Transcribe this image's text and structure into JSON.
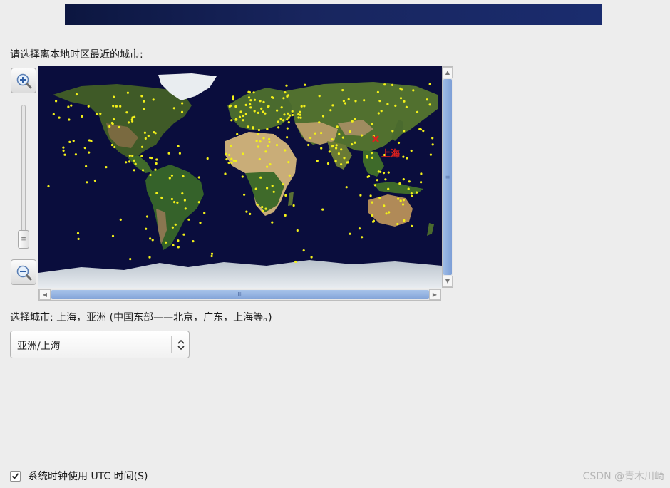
{
  "header": {
    "banner_color": "#18255e"
  },
  "prompt": "请选择离本地时区最近的城市:",
  "map": {
    "selected_city_label": "上海",
    "zoom_in_icon": "zoom-in-magnifier-icon",
    "zoom_out_icon": "zoom-out-magnifier-icon",
    "ocean_color": "#0a0d3d",
    "city_dot_color": "#f2f01a",
    "selected_marker_color": "#e0201c",
    "scroll_grip": "≡",
    "hscroll_grip": "III"
  },
  "selected_city_text": "选择城市: 上海，亚洲 (中国东部——北京，广东，上海等。)",
  "timezone_select": {
    "value": "亚洲/上海"
  },
  "utc_checkbox": {
    "label": "系统时钟使用 UTC 时间(S)",
    "checked": true
  },
  "watermark": "CSDN @青木川崎"
}
